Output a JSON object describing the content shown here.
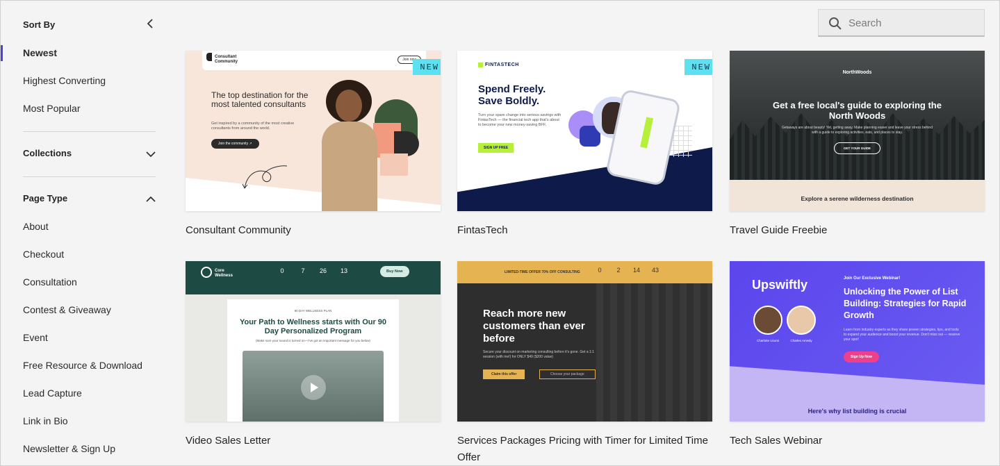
{
  "sidebar": {
    "sort_heading": "Sort By",
    "sort_options": [
      {
        "label": "Newest",
        "active": true
      },
      {
        "label": "Highest Converting",
        "active": false
      },
      {
        "label": "Most Popular",
        "active": false
      }
    ],
    "collections_heading": "Collections",
    "page_type_heading": "Page Type",
    "page_types": [
      "About",
      "Checkout",
      "Consultation",
      "Contest & Giveaway",
      "Event",
      "Free Resource & Download",
      "Lead Capture",
      "Link in Bio",
      "Newsletter & Sign Up"
    ]
  },
  "search": {
    "placeholder": "Search",
    "value": ""
  },
  "badge_new": "NEW",
  "templates": [
    {
      "title": "Consultant Community",
      "new": true,
      "preview": {
        "brand": "Consultant Community",
        "nav_button": "Join now",
        "headline": "The top destination for the most talented consultants",
        "subtext": "Get inspired by a community of the most creative consultants from around the world.",
        "cta": "Join the community ↗"
      }
    },
    {
      "title": "FintasTech",
      "new": true,
      "preview": {
        "brand": "FINTASTECH",
        "headline": "Spend Freely. Save Boldly.",
        "subtext": "Turn your spare change into serious savings with FintasTech — the financial tech app that's about to become your new money-saving BFF.",
        "cta": "SIGN UP FREE"
      }
    },
    {
      "title": "Travel Guide Freebie",
      "new": false,
      "preview": {
        "brand": "NorthWoods",
        "headline": "Get a free local's guide to exploring the North Woods",
        "subtext": "Getaways are about beauty! Yet, getting away. Make planning easier and leave your stress behind with a guide to exploring activities, eats, and places to stay.",
        "cta": "GET YOUR GUIDE",
        "footer": "Explore a serene wilderness destination"
      }
    },
    {
      "title": "Video Sales Letter",
      "new": false,
      "preview": {
        "brand": "Core Wellness",
        "timer": [
          "0",
          "7",
          "26",
          "13"
        ],
        "nav_button": "Buy Now",
        "plan": "90 DAY WELLNESS PLAN",
        "headline": "Your Path to Wellness starts with Our 90 Day Personalized Program",
        "subtext": "(Make sure your sound is turned on—I've got an important message for you below)"
      }
    },
    {
      "title": "Services Packages Pricing with Timer for Limited Time Offer",
      "new": false,
      "preview": {
        "banner": "LIMITED-TIME OFFER 70% OFF CONSULTING",
        "timer": [
          "0",
          "2",
          "14",
          "43"
        ],
        "headline": "Reach more new customers than ever before",
        "subtext": "Secure your discount on marketing consulting before it's gone. Get a 1:1 session (with me!) for ONLY $49 ($200 value)",
        "cta_primary": "Claim this offer",
        "cta_secondary": "Choose your package"
      }
    },
    {
      "title": "Tech Sales Webinar",
      "new": false,
      "preview": {
        "brand": "Upswiftly",
        "eyebrow": "Join Our Exclusive Webinar!",
        "headline": "Unlocking the Power of List Building: Strategies for Rapid Growth",
        "subtext": "Learn from industry experts as they share proven strategies, tips, and tools to expand your audience and boost your revenue. Don't miss out — reserve your spot!",
        "cta": "Sign Up Now",
        "speakers": [
          "Charlotte Uzumi",
          "Charles Amesly"
        ],
        "footer": "Here's why list building is crucial"
      }
    }
  ],
  "colors": {
    "accent": "#4b3fe0",
    "badge": "#5de0f0",
    "background": "#f4f4f4"
  }
}
